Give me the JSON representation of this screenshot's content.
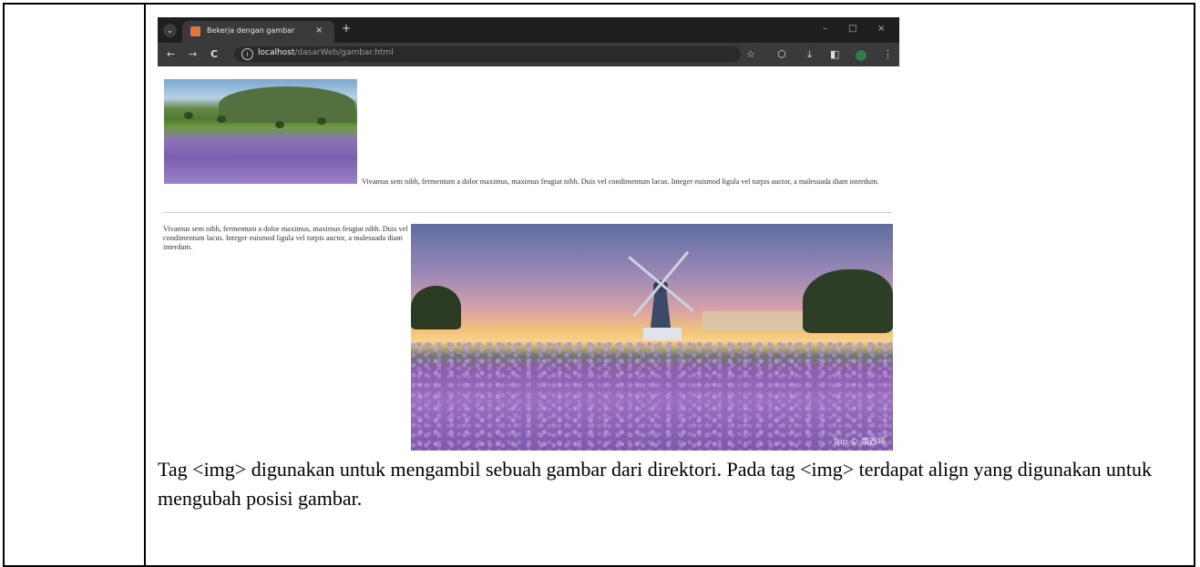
{
  "browser": {
    "tab": {
      "title": "Bekerja dengan gambar",
      "close_icon": "×"
    },
    "new_tab_icon": "+",
    "window_controls": {
      "minimize": "–",
      "maximize": "□",
      "close": "×"
    },
    "nav": {
      "back": "←",
      "forward": "→",
      "reload": "C"
    },
    "address": {
      "host": "localhost",
      "path": "/dasarWeb/gambar.html"
    }
  },
  "page": {
    "inline_paragraph": "Vivamus sem nibh, fermentum a dolor maximus, maximus feugiat nibh. Duis vel condimentum lacus. Integer euismod ligula vel turpis auctor, a malesuada diam interdum.",
    "float_paragraph": "Vivamus sem nibh, fermentum a dolor maximus, maximus feugiat nibh. Duis vel condimentum lacus. Integer euismod ligula vel turpis auctor, a malesuada diam interdum.",
    "watermark": "Trip © 康西坪"
  },
  "caption": "Tag <img> digunakan untuk mengambil sebuah gambar dari direktori. Pada tag <img> terdapat align yang digunakan untuk mengubah posisi gambar."
}
